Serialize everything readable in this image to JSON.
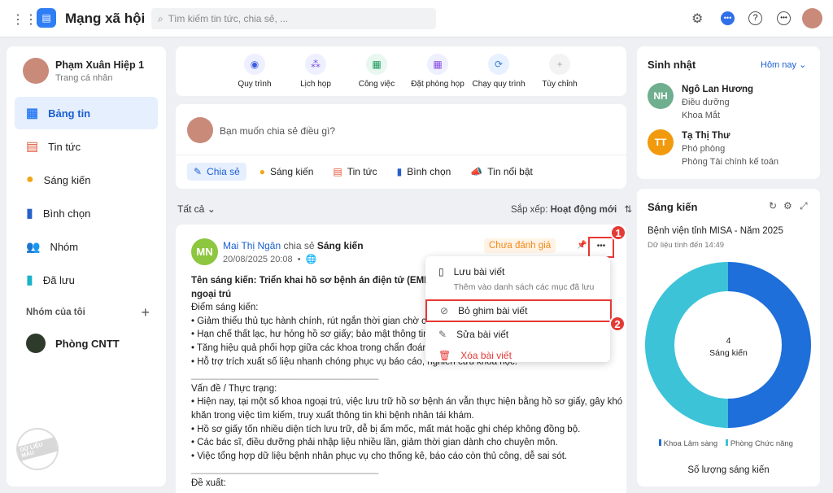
{
  "header": {
    "app_title": "Mạng xã hội",
    "search_placeholder": "Tìm kiếm tin tức, chia sẻ, ..."
  },
  "profile": {
    "name": "Phạm Xuân Hiệp 1",
    "subtitle": "Trang cá nhân"
  },
  "sidebar": {
    "items": [
      {
        "label": "Bảng tin"
      },
      {
        "label": "Tin tức"
      },
      {
        "label": "Sáng kiến"
      },
      {
        "label": "Bình chọn"
      },
      {
        "label": "Nhóm"
      },
      {
        "label": "Đã lưu"
      }
    ],
    "groups_title": "Nhóm của tôi",
    "groups": [
      {
        "label": "Phòng CNTT"
      }
    ],
    "watermark": "DỮ LIỆU MẪU"
  },
  "quick_actions": [
    {
      "label": "Quy trình"
    },
    {
      "label": "Lịch họp"
    },
    {
      "label": "Công việc"
    },
    {
      "label": "Đặt phòng họp"
    },
    {
      "label": "Chạy quy trình"
    },
    {
      "label": "Tùy chỉnh"
    }
  ],
  "composer": {
    "placeholder": "Bạn muốn chia sẻ điều gì?",
    "types": [
      {
        "label": "Chia sẻ"
      },
      {
        "label": "Sáng kiến"
      },
      {
        "label": "Tin tức"
      },
      {
        "label": "Bình chọn"
      },
      {
        "label": "Tin nổi bật"
      }
    ]
  },
  "feed": {
    "filter": "Tất cả",
    "sort_label": "Sắp xếp:",
    "sort_value": "Hoạt động mới"
  },
  "post": {
    "author_initials": "MN",
    "author": "Mai Thị Ngân",
    "action": "chia sẻ",
    "type": "Sáng kiến",
    "time": "20/08/2025 20:08",
    "status": "Chưa đánh giá",
    "title": "Tên sáng kiến: Triển khai hồ sơ bệnh án điện tử (EMR) th",
    "title2": "ngoại trú",
    "lines": [
      "Điểm sáng kiến:",
      "• Giảm thiểu thủ tục hành chính, rút ngắn thời gian chờ củ",
      "• Hạn chế thất lạc, hư hỏng hồ sơ giấy; bảo mật thông tin l",
      "• Tăng hiệu quả phối hợp giữa các khoa trong chẩn đoán,",
      "• Hỗ trợ trích xuất số liệu nhanh chóng phục vụ báo cáo, nghiên cứu khoa học.",
      "____________________________________",
      "Vấn đề / Thực trạng:",
      "• Hiện nay, tại một số khoa ngoại trú, việc lưu trữ hồ sơ bệnh án vẫn thực hiện bằng hồ sơ giấy, gây khó",
      "khăn trong việc tìm kiếm, truy xuất thông tin khi bệnh nhân tái khám.",
      "• Hồ sơ giấy tốn nhiều diện tích lưu trữ, dễ bị ẩm mốc, mất mát hoặc ghi chép không đồng bộ.",
      "• Các bác sĩ, điều dưỡng phải nhập liệu nhiều lần, giảm thời gian dành cho chuyên môn.",
      "• Việc tổng hợp dữ liệu bệnh nhân phục vụ cho thống kê, báo cáo còn thủ công, dễ sai sót.",
      "____________________________________",
      "Đề xuất:"
    ]
  },
  "menu": {
    "save": "Lưu bài viết",
    "save_desc": "Thêm vào danh sách các mục đã lưu",
    "unpin": "Bỏ ghim bài viết",
    "edit": "Sửa bài viết",
    "delete": "Xóa bài viết"
  },
  "steps": [
    "1",
    "2"
  ],
  "birthday": {
    "title": "Sinh nhật",
    "filter": "Hôm nay",
    "people": [
      {
        "initials": "NH",
        "name": "Ngô Lan Hương",
        "role": "Điều dưỡng",
        "dept": "Khoa Mắt",
        "color": "#6fae8f"
      },
      {
        "initials": "TT",
        "name": "Tạ Thị Thư",
        "role": "Phó phòng",
        "dept": "Phòng Tài chính kế toán",
        "color": "#f29a0e"
      }
    ]
  },
  "initiative": {
    "title": "Sáng kiến",
    "org": "Bệnh viện tỉnh MISA - Năm 2025",
    "updated": "Dữ liệu tính đến 14:49",
    "center_value": "4",
    "center_label": "Sáng kiến",
    "footer": "Số lượng sáng kiến",
    "chart_data": {
      "type": "pie",
      "title": "Sáng kiến",
      "series": [
        {
          "name": "Khoa Lâm sàng",
          "value": 2,
          "color": "#1e6fd9"
        },
        {
          "name": "Phòng Chức năng",
          "value": 2,
          "color": "#3cc3d8"
        }
      ],
      "legend": "bottom"
    }
  }
}
